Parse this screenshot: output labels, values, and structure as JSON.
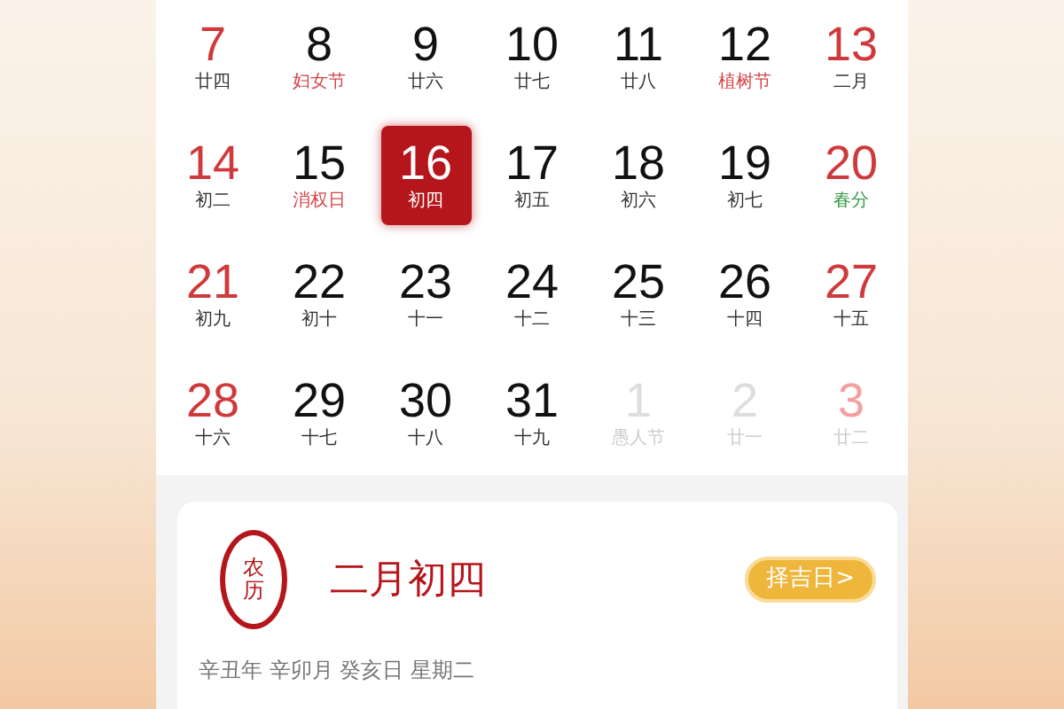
{
  "calendar": {
    "weeks": [
      [
        {
          "day": "7",
          "label": "廿四",
          "kind": "weekend",
          "color": "#333333",
          "selected": false
        },
        {
          "day": "8",
          "label": "妇女节",
          "kind": "weekday",
          "color": "#d5474a",
          "selected": false
        },
        {
          "day": "9",
          "label": "廿六",
          "kind": "weekday",
          "color": "#333333",
          "selected": false
        },
        {
          "day": "10",
          "label": "廿七",
          "kind": "weekday",
          "color": "#333333",
          "selected": false
        },
        {
          "day": "11",
          "label": "廿八",
          "kind": "weekday",
          "color": "#333333",
          "selected": false
        },
        {
          "day": "12",
          "label": "植树节",
          "kind": "weekday",
          "color": "#d5474a",
          "selected": false
        },
        {
          "day": "13",
          "label": "二月",
          "kind": "weekend",
          "color": "#333333",
          "selected": false
        }
      ],
      [
        {
          "day": "14",
          "label": "初二",
          "kind": "weekend",
          "color": "#333333",
          "selected": false
        },
        {
          "day": "15",
          "label": "消权日",
          "kind": "weekday",
          "color": "#d5474a",
          "selected": false
        },
        {
          "day": "16",
          "label": "初四",
          "kind": "weekday",
          "color": "#ffffff",
          "selected": true
        },
        {
          "day": "17",
          "label": "初五",
          "kind": "weekday",
          "color": "#333333",
          "selected": false
        },
        {
          "day": "18",
          "label": "初六",
          "kind": "weekday",
          "color": "#333333",
          "selected": false
        },
        {
          "day": "19",
          "label": "初七",
          "kind": "weekday",
          "color": "#333333",
          "selected": false
        },
        {
          "day": "20",
          "label": "春分",
          "kind": "weekend",
          "color": "#3a9a4a",
          "selected": false
        }
      ],
      [
        {
          "day": "21",
          "label": "初九",
          "kind": "weekend",
          "color": "#333333",
          "selected": false
        },
        {
          "day": "22",
          "label": "初十",
          "kind": "weekday",
          "color": "#333333",
          "selected": false
        },
        {
          "day": "23",
          "label": "十一",
          "kind": "weekday",
          "color": "#333333",
          "selected": false
        },
        {
          "day": "24",
          "label": "十二",
          "kind": "weekday",
          "color": "#333333",
          "selected": false
        },
        {
          "day": "25",
          "label": "十三",
          "kind": "weekday",
          "color": "#333333",
          "selected": false
        },
        {
          "day": "26",
          "label": "十四",
          "kind": "weekday",
          "color": "#333333",
          "selected": false
        },
        {
          "day": "27",
          "label": "十五",
          "kind": "weekend",
          "color": "#333333",
          "selected": false
        }
      ],
      [
        {
          "day": "28",
          "label": "十六",
          "kind": "weekend",
          "color": "#333333",
          "selected": false
        },
        {
          "day": "29",
          "label": "十七",
          "kind": "weekday",
          "color": "#333333",
          "selected": false
        },
        {
          "day": "30",
          "label": "十八",
          "kind": "weekday",
          "color": "#333333",
          "selected": false
        },
        {
          "day": "31",
          "label": "十九",
          "kind": "weekday",
          "color": "#333333",
          "selected": false
        },
        {
          "day": "1",
          "label": "愚人节",
          "kind": "adjacent",
          "color": "#cccccc",
          "selected": false
        },
        {
          "day": "2",
          "label": "廿一",
          "kind": "adjacent",
          "color": "#cccccc",
          "selected": false
        },
        {
          "day": "3",
          "label": "廿二",
          "kind": "adjacent-weekend",
          "color": "#cccccc",
          "selected": false
        }
      ]
    ]
  },
  "lunar_card": {
    "seal": "农历",
    "title": "二月初四",
    "button": "择吉日>",
    "ganzhi": "辛丑年 辛卯月 癸亥日 星期二"
  }
}
